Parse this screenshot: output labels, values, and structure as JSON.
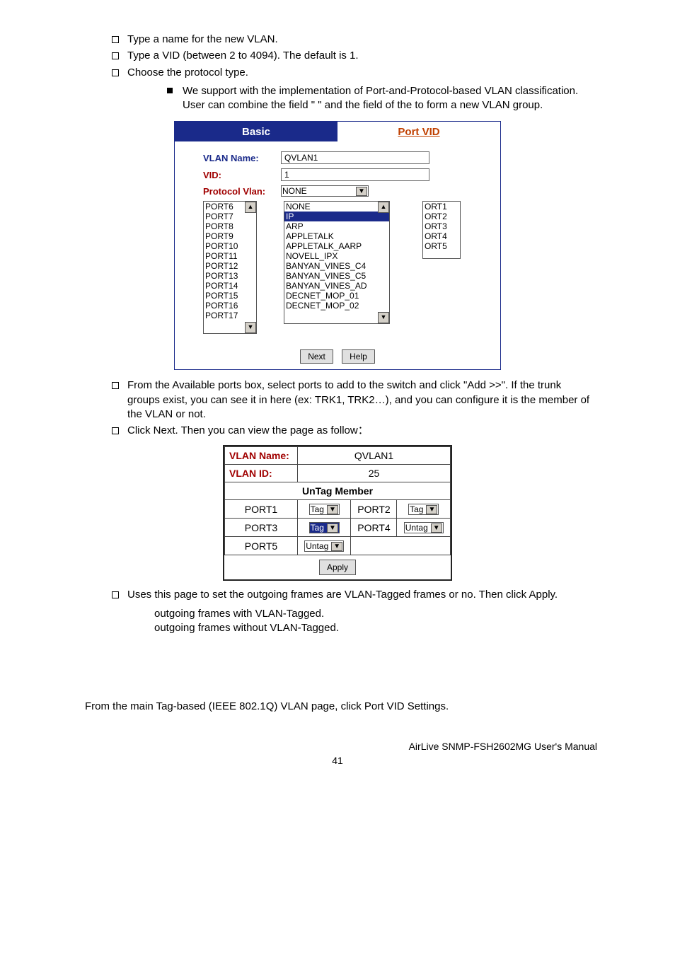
{
  "content": {
    "l1_a": "Type a name for the new VLAN.",
    "l1_b": "Type a VID (between 2 to 4094). The default is 1.",
    "l1_c": "Choose the protocol type.",
    "l2_a": "We support         with the implementation of Port-and-Protocol-based VLAN classification. User can combine the field \"              \" and the field of the           to form a new VLAN group.",
    "l1_d": "From the Available ports box, select ports to add to the switch and click \"Add >>\". If the trunk groups exist, you can see it in here (ex: TRK1, TRK2…), and you can configure it is the member of the VLAN or not.",
    "l1_e": "Click Next. Then you can view the page as follow：",
    "l1_f": "Uses this page to set the outgoing frames are VLAN-Tagged frames or no. Then click Apply.",
    "ind_tag": "         outgoing frames with VLAN-Tagged.",
    "ind_untag": "            outgoing frames without VLAN-Tagged.",
    "portvid_line": "From the main Tag-based (IEEE 802.1Q) VLAN page, click Port VID Settings."
  },
  "fig1": {
    "tab_basic": "Basic",
    "tab_portvid": "Port VID",
    "label_vlan_name": "VLAN Name:",
    "label_vid": "VID:",
    "label_protocol": "Protocol Vlan:",
    "val_vlan_name": "QVLAN1",
    "val_vid": "1",
    "sel_protocol": "NONE",
    "ports_left": [
      "PORT6",
      "PORT7",
      "PORT8",
      "PORT9",
      "PORT10",
      "PORT11",
      "PORT12",
      "PORT13",
      "PORT14",
      "PORT15",
      "PORT16",
      "PORT17"
    ],
    "protocol_options": [
      "NONE",
      "IP",
      "ARP",
      "APPLETALK",
      "APPLETALK_AARP",
      "NOVELL_IPX",
      "BANYAN_VINES_C4",
      "BANYAN_VINES_C5",
      "BANYAN_VINES_AD",
      "DECNET_MOP_01",
      "DECNET_MOP_02"
    ],
    "ports_right": [
      "ORT1",
      "ORT2",
      "ORT3",
      "ORT4",
      "ORT5"
    ],
    "btn_next": "Next",
    "btn_help": "Help"
  },
  "fig2": {
    "label_name": "VLAN Name:",
    "label_id": "VLAN ID:",
    "val_name": "QVLAN1",
    "val_id": "25",
    "head_untag": "UnTag Member",
    "rows": [
      {
        "p": "PORT1",
        "v": "Tag",
        "p2": "PORT2",
        "v2": "Tag"
      },
      {
        "p": "PORT3",
        "v": "Tag",
        "p2": "PORT4",
        "v2": "Untag"
      },
      {
        "p": "PORT5",
        "v": "Untag",
        "p2": "",
        "v2": ""
      }
    ],
    "btn_apply": "Apply"
  },
  "footer": {
    "right": "AirLive SNMP-FSH2602MG User's Manual",
    "page": "41"
  }
}
